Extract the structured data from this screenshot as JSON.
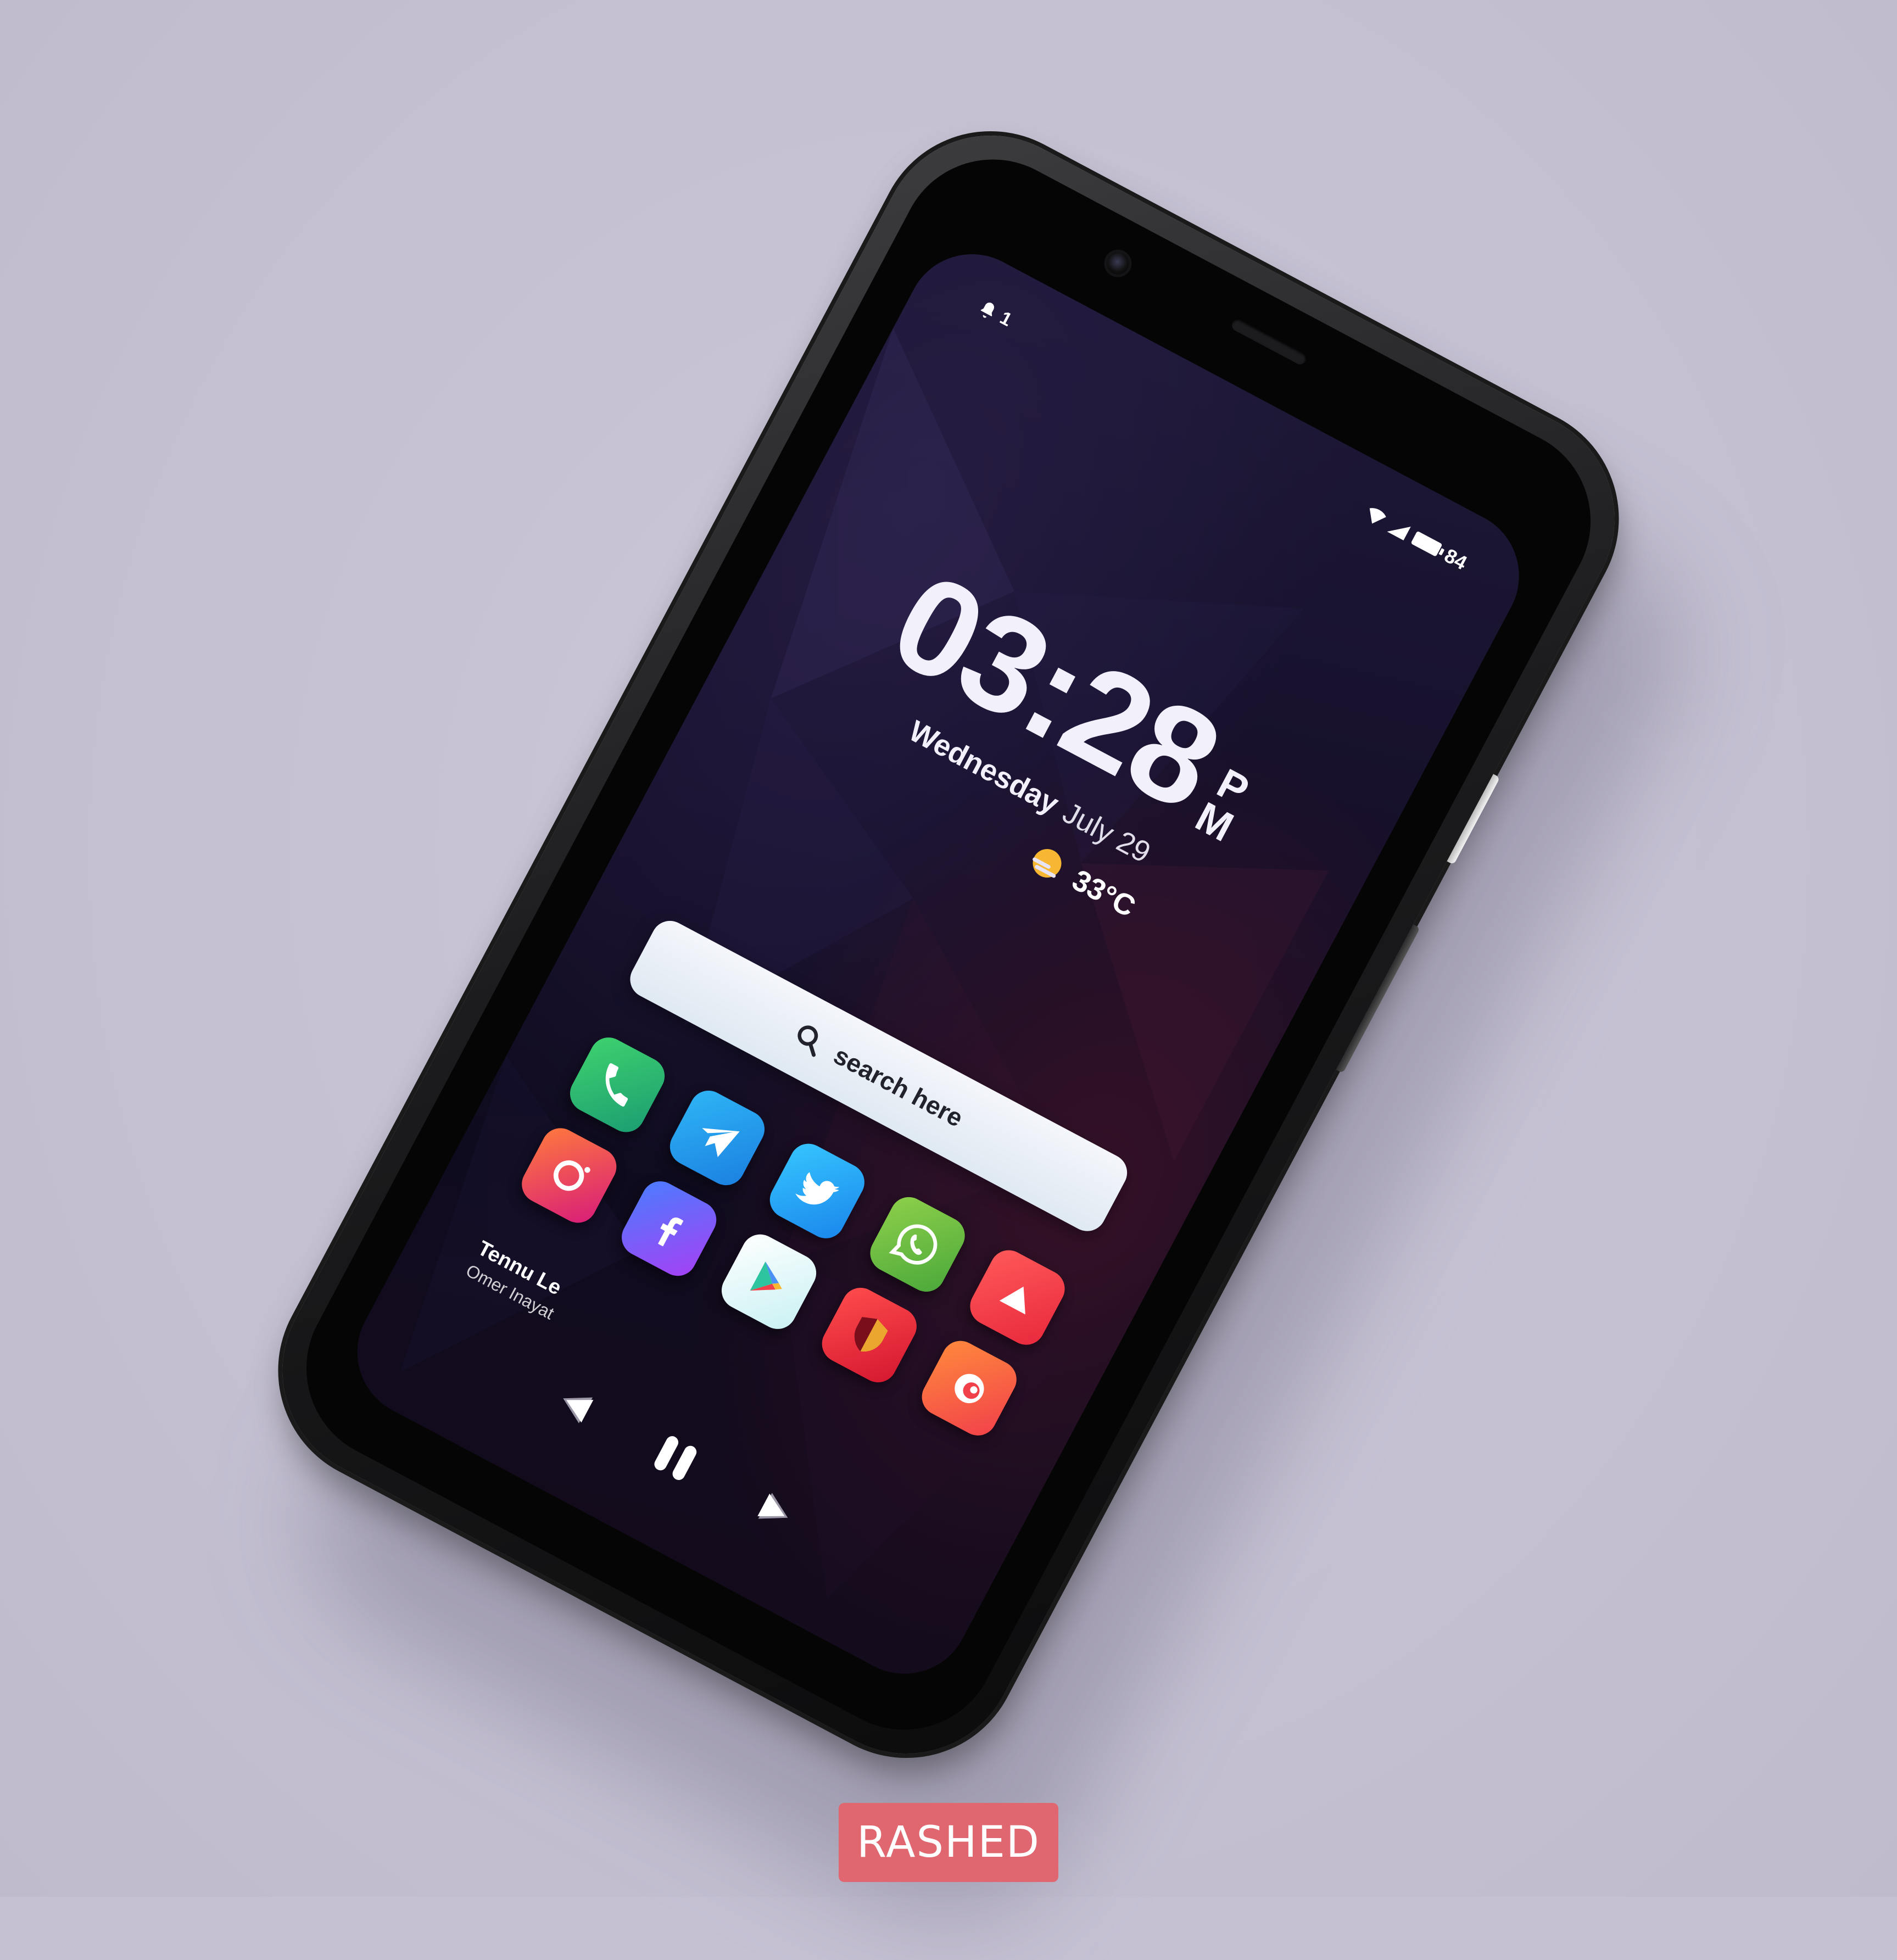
{
  "status_bar": {
    "notification_count": "1",
    "battery_level": "84"
  },
  "clock": {
    "time": "03:28",
    "am_pm_top": "P",
    "am_pm_bottom": "M",
    "weekday": "Wednesday",
    "date": "July 29",
    "temperature": "33°C"
  },
  "search": {
    "label": "search here"
  },
  "apps": [
    {
      "name": "phone",
      "icon": "phone-icon",
      "color_a": "#3fd26e",
      "color_b": "#1b9d72"
    },
    {
      "name": "telegram",
      "icon": "paper-plane-icon",
      "color_a": "#2fb6f6",
      "color_b": "#1b7fe0"
    },
    {
      "name": "twitter",
      "icon": "bird-icon",
      "color_a": "#36c6ff",
      "color_b": "#1a86ec"
    },
    {
      "name": "whatsapp",
      "icon": "chat-phone-icon",
      "color_a": "#8fd04b",
      "color_b": "#4aa83a"
    },
    {
      "name": "youtube",
      "icon": "play-icon",
      "color_a": "#ff5a5a",
      "color_b": "#e8283c"
    },
    {
      "name": "camera",
      "icon": "camera-lens-icon",
      "color_a": "#ff7a3d",
      "color_b": "#d81b7a"
    },
    {
      "name": "facebook",
      "icon": "facebook-f-icon",
      "color_a": "#4a7dff",
      "color_b": "#a640f5"
    },
    {
      "name": "play-store",
      "icon": "play-triangle-icon",
      "color_a": "#ffffff",
      "color_b": "#c9f1f3"
    },
    {
      "name": "shield-app",
      "icon": "shield-icon",
      "color_a": "#ff4d4d",
      "color_b": "#d4162f"
    },
    {
      "name": "firefox",
      "icon": "fox-icon",
      "color_a": "#ff8a3d",
      "color_b": "#f2404a"
    }
  ],
  "credit": {
    "line1": "Tennu Le",
    "line2": "Omer Inayat"
  },
  "watermark": {
    "text": "RASHED"
  }
}
